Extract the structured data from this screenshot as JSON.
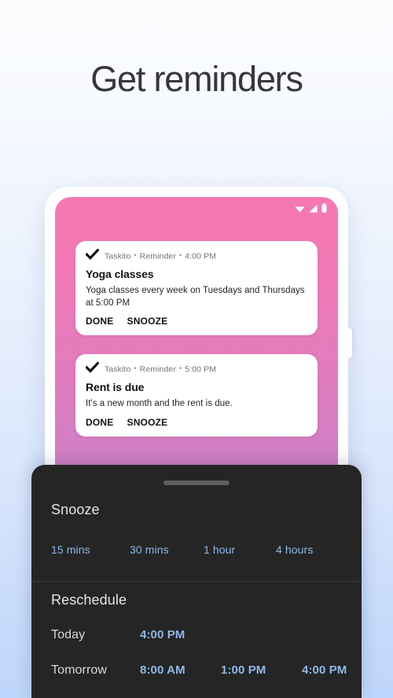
{
  "headline": "Get reminders",
  "colors": {
    "background_top": "#fbfcfe",
    "background_bottom": "#bed6fb",
    "headline_text": "#35373b",
    "screen_gradient_top": "#f678b3",
    "screen_gradient_bottom": "#b081d2",
    "sheet_background": "#252525",
    "accent_blue": "#8fb8e8",
    "card_background": "#ffffff"
  },
  "phone": {
    "status_bar": {
      "icons": [
        "wifi-icon",
        "signal-icon",
        "battery-icon"
      ]
    },
    "notifications": [
      {
        "app": "Taskito",
        "separator": "•",
        "channel": "Reminder",
        "time": "4:00 PM",
        "title": "Yoga classes",
        "body": "Yoga classes every week on Tuesdays and Thursdays at 5:00 PM",
        "action_done": "DONE",
        "action_snooze": "SNOOZE",
        "icon": "check-icon"
      },
      {
        "app": "Taskito",
        "separator": "•",
        "channel": "Reminder",
        "time": "5:00 PM",
        "title": "Rent is due",
        "body": "It's a new month and the rent is due.",
        "action_done": "DONE",
        "action_snooze": "SNOOZE",
        "icon": "check-icon"
      }
    ]
  },
  "bottom_sheet": {
    "drag_handle": "drag-handle",
    "snooze": {
      "title": "Snooze",
      "options": [
        "15 mins",
        "30 mins",
        "1 hour",
        "4 hours"
      ]
    },
    "reschedule": {
      "title": "Reschedule",
      "rows": [
        {
          "label": "Today",
          "times": [
            "4:00 PM"
          ]
        },
        {
          "label": "Tomorrow",
          "times": [
            "8:00 AM",
            "1:00 PM",
            "4:00 PM"
          ]
        }
      ]
    }
  }
}
